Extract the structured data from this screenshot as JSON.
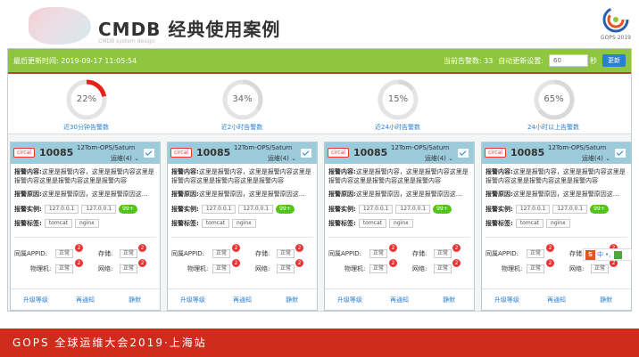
{
  "slide": {
    "title": "CMDB 经典使用案例",
    "subtitle": "CMDB system design",
    "logo_text": "GOPS 2019",
    "footer": "GOPS 全球运维大会2019·上海站"
  },
  "toolbar": {
    "last_update_label": "最后更新时间: 2019-09-17 11:05:54",
    "alarm_count_label": "当前告警数: 33",
    "auto_refresh_label": "自动更新设置:",
    "refresh_value": "60",
    "refresh_unit": "秒",
    "refresh_button": "更新"
  },
  "gauges": [
    {
      "percent": 22,
      "label": "22%",
      "caption": "近30分钟告警数",
      "color": "#e62117"
    },
    {
      "percent": 34,
      "label": "34%",
      "caption": "近2小时告警数",
      "color": "#d9d9d9"
    },
    {
      "percent": 15,
      "label": "15%",
      "caption": "近24小时告警数",
      "color": "#d9d9d9"
    },
    {
      "percent": 65,
      "label": "65%",
      "caption": "24小时以上告警数",
      "color": "#d9d9d9"
    }
  ],
  "card": {
    "badge": "circal",
    "id": "10085",
    "project": "12Tom-OPS/Saturn",
    "group": "运维(4) ⌄",
    "content_key": "报警内容:",
    "content_text": "这里是报警内容，这里是报警内容这里是报警内容这里是报警内容这里是报警内容",
    "reason_key": "报警原因:",
    "reason_text": "这里是报警原因，这里是报警原因这...",
    "instance_key": "报警实例:",
    "instances": [
      "127.0.0.1",
      "127.0.0.1"
    ],
    "instance_more": "99+",
    "tag_key": "报警标签:",
    "tags": [
      "tomcat",
      "nginx"
    ],
    "appid_label": "同属APPID:",
    "storage_label": "存储:",
    "physical_label": "物理机:",
    "network_label": "网络:",
    "status_normal": "正常",
    "status_count": "2",
    "action_upgrade": "升级等级",
    "action_renotify": "再通知",
    "action_mute": "静默"
  },
  "ime": {
    "logo": "S",
    "lang": "中",
    "punct": "•,"
  }
}
